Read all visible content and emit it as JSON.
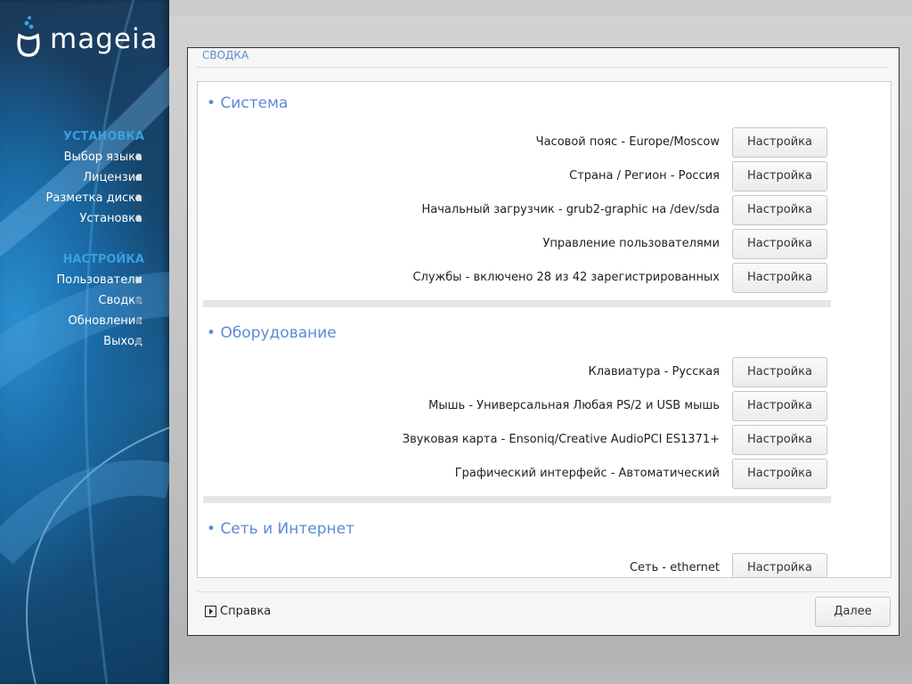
{
  "sidebar": {
    "logo": "mageia",
    "sections": [
      {
        "title": "УСТАНОВКА",
        "items": [
          {
            "label": "Выбор языка"
          },
          {
            "label": "Лицензия"
          },
          {
            "label": "Разметка диска"
          },
          {
            "label": "Установка"
          }
        ]
      },
      {
        "title": "НАСТРОЙКА",
        "items": [
          {
            "label": "Пользователи"
          },
          {
            "label": "Сводка"
          },
          {
            "label": "Обновления"
          },
          {
            "label": "Выход"
          }
        ]
      }
    ]
  },
  "dialog": {
    "title": "СВОДКА",
    "sections": [
      {
        "title": "Система",
        "rows": [
          {
            "label": "Часовой пояс - Europe/Moscow",
            "button": "Настройка"
          },
          {
            "label": "Страна / Регион - Россия",
            "button": "Настройка"
          },
          {
            "label": "Начальный загрузчик - grub2-graphic на /dev/sda",
            "button": "Настройка"
          },
          {
            "label": "Управление пользователями",
            "button": "Настройка"
          },
          {
            "label": "Службы - включено 28 из 42 зарегистрированных",
            "button": "Настройка"
          }
        ]
      },
      {
        "title": "Оборудование",
        "rows": [
          {
            "label": "Клавиатура - Русская",
            "button": "Настройка"
          },
          {
            "label": "Мышь - Универсальная Любая PS/2 и USB мышь",
            "button": "Настройка"
          },
          {
            "label": "Звуковая карта - Ensoniq/Creative AudioPCI ES1371+",
            "button": "Настройка"
          },
          {
            "label": "Графический интерфейс - Автоматический",
            "button": "Настройка"
          }
        ]
      },
      {
        "title": "Сеть и Интернет",
        "rows": [
          {
            "label": "Сеть - ethernet",
            "button": "Настройка"
          }
        ]
      }
    ],
    "help": "Справка",
    "next": "Далее"
  }
}
